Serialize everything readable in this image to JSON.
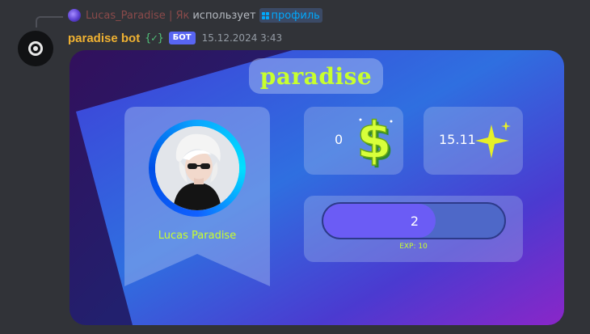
{
  "reply": {
    "author": "Lucas_Paradise | Як",
    "action_text": "использует",
    "command": "профиль"
  },
  "message": {
    "bot_name": "paradise bot",
    "verified_mark": "{✓}",
    "bot_tag": "БОТ",
    "timestamp": "15.12.2024 3:43"
  },
  "card": {
    "title": "paradise",
    "user_name": "Lucas Paradise",
    "money": "0",
    "stars": "15.11",
    "level": "2",
    "exp_label": "EXP: 10",
    "level_progress": 0.62,
    "colors": {
      "accent_text": "#c8ff2e",
      "progress_fill": "#6b5cf5",
      "progress_track": "#4e68c8",
      "bot_name": "#f0b232",
      "bot_tag": "#5865f2"
    },
    "icons": {
      "money": "dollar-sign-icon",
      "stars": "sparkle-star-icon"
    }
  }
}
